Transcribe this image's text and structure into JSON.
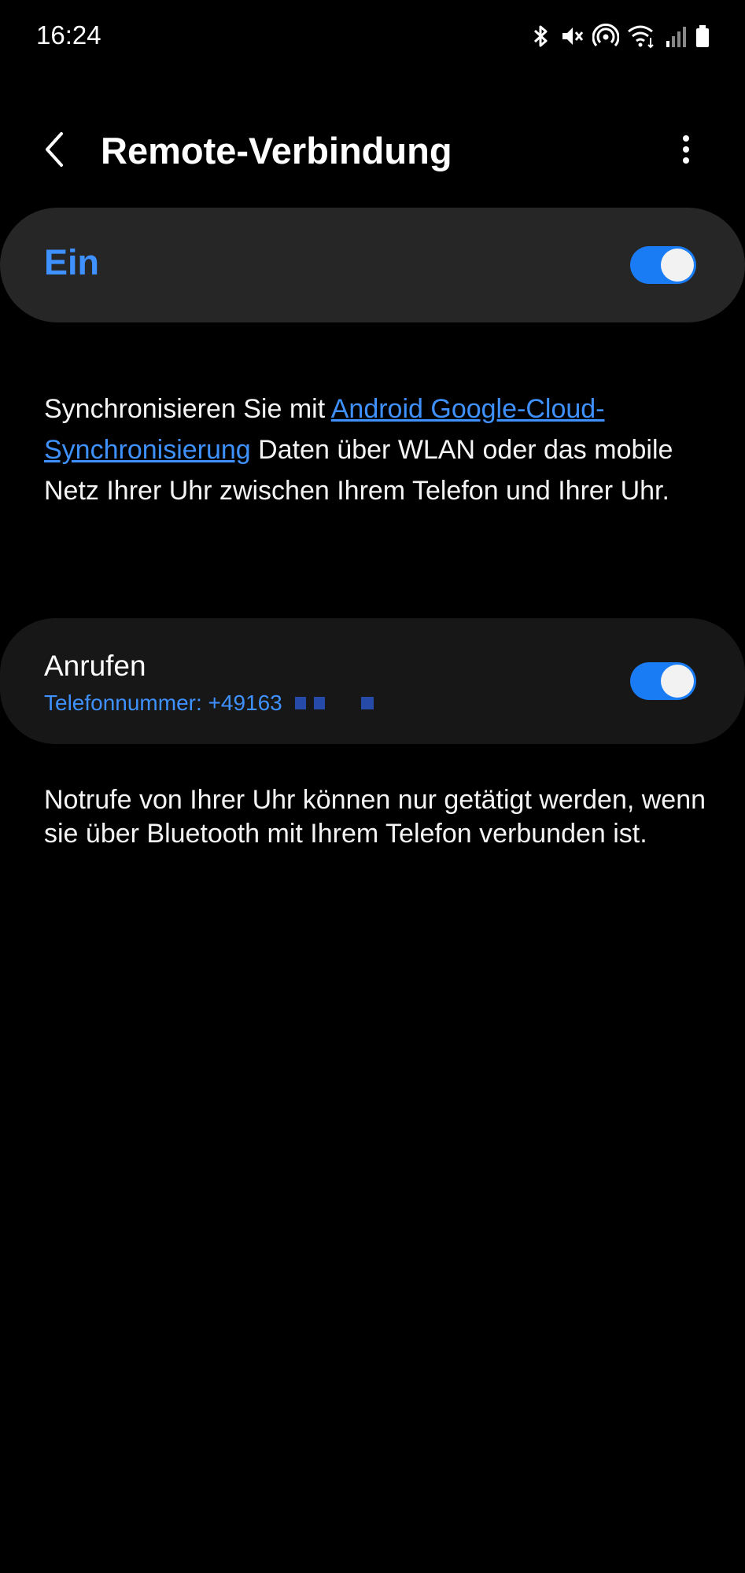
{
  "status_bar": {
    "time": "16:24",
    "icons": [
      "bluetooth-icon",
      "mute-icon",
      "hotspot-icon",
      "wifi-icon",
      "signal-icon",
      "battery-icon"
    ]
  },
  "app_bar": {
    "title": "Remote-Verbindung",
    "back_icon": "chevron-left-icon",
    "more_icon": "more-vert-icon"
  },
  "master_switch": {
    "label": "Ein",
    "enabled": true,
    "accent_color": "#3e91ff"
  },
  "description": {
    "text_before_link": "Synchronisieren Sie mit ",
    "link_text": "Android Google-Cloud-Synchronisierung",
    "text_after_link": " Daten über WLAN oder das mobile Netz Ihrer Uhr zwischen Ihrem Telefon und Ihrer Uhr."
  },
  "calls": {
    "title": "Anrufen",
    "subtitle": "Telefonnummer: +49163",
    "enabled": true
  },
  "note": {
    "text": "Notrufe von Ihrer Uhr können nur getätigt werden, wenn sie über Bluetooth mit Ihrem Telefon verbunden ist."
  },
  "colors": {
    "background": "#000000",
    "card": "#262626",
    "card_dark": "#171717",
    "accent": "#3e91ff",
    "toggle_on": "#1a7cf5"
  }
}
